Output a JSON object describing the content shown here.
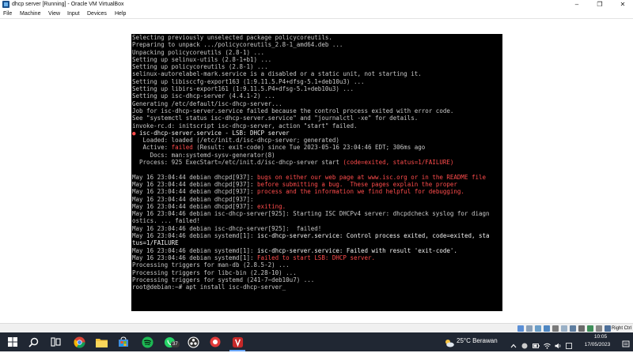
{
  "window": {
    "title": "dhcp server [Running] - Oracle VM VirtualBox",
    "minimize_icon": "minimize-icon",
    "restore_icon": "restore-icon",
    "close_icon": "close-icon"
  },
  "menubar": {
    "items": [
      "File",
      "Machine",
      "View",
      "Input",
      "Devices",
      "Help"
    ]
  },
  "console": {
    "lines": [
      [
        {
          "t": "Selecting previously unselected package policycoreutils."
        }
      ],
      [
        {
          "t": "Preparing to unpack .../policycoreutils_2.8-1_amd64.deb ..."
        }
      ],
      [
        {
          "t": "Unpacking policycoreutils (2.8-1) ..."
        }
      ],
      [
        {
          "t": "Setting up selinux-utils (2.8-1+b1) ..."
        }
      ],
      [
        {
          "t": "Setting up policycoreutils (2.8-1) ..."
        }
      ],
      [
        {
          "t": "selinux-autorelabel-mark.service is a disabled or a static unit, not starting it."
        }
      ],
      [
        {
          "t": "Setting up libisccfg-export163 (1:9.11.5.P4+dfsg-5.1+deb10u3) ..."
        }
      ],
      [
        {
          "t": "Setting up libirs-export161 (1:9.11.5.P4+dfsg-5.1+deb10u3) ..."
        }
      ],
      [
        {
          "t": "Setting up isc-dhcp-server (4.4.1-2) ..."
        }
      ],
      [
        {
          "t": "Generating /etc/default/isc-dhcp-server..."
        }
      ],
      [
        {
          "t": "Job for isc-dhcp-server.service failed because the control process exited with error code."
        }
      ],
      [
        {
          "t": "See \"systemctl status isc-dhcp-server.service\" and \"journalctl -xe\" for details."
        }
      ],
      [
        {
          "t": "invoke-rc.d: initscript isc-dhcp-server, action \"start\" failed."
        }
      ],
      [
        {
          "t": "●",
          "c": "red"
        },
        {
          "t": " isc-dhcp-server.service - LSB: DHCP server",
          "c": "white"
        }
      ],
      [
        {
          "t": "   Loaded: loaded (/etc/init.d/isc-dhcp-server; generated)"
        }
      ],
      [
        {
          "t": "   Active: "
        },
        {
          "t": "failed",
          "c": "red"
        },
        {
          "t": " (Result: exit-code) since Tue 2023-05-16 23:04:46 EDT; 306ms ago"
        }
      ],
      [
        {
          "t": "     Docs: man:systemd-sysv-generator(8)"
        }
      ],
      [
        {
          "t": "  Process: 925 ExecStart=/etc/init.d/isc-dhcp-server start "
        },
        {
          "t": "(code=exited, status=1/FAILURE)",
          "c": "red"
        }
      ],
      [
        {
          "t": ""
        }
      ],
      [
        {
          "t": "May 16 23:04:44 debian dhcpd[937]: "
        },
        {
          "t": "bugs on either our web page at www.isc.org or in the README file",
          "c": "red"
        }
      ],
      [
        {
          "t": "May 16 23:04:44 debian dhcpd[937]: "
        },
        {
          "t": "before submitting a bug.  These pages explain the proper",
          "c": "red"
        }
      ],
      [
        {
          "t": "May 16 23:04:44 debian dhcpd[937]: "
        },
        {
          "t": "process and the information we find helpful for debugging.",
          "c": "red"
        }
      ],
      [
        {
          "t": "May 16 23:04:44 debian dhcpd[937]:"
        }
      ],
      [
        {
          "t": "May 16 23:04:44 debian dhcpd[937]: "
        },
        {
          "t": "exiting.",
          "c": "red"
        }
      ],
      [
        {
          "t": "May 16 23:04:46 debian isc-dhcp-server[925]: Starting ISC DHCPv4 server: dhcpdcheck syslog for diagn"
        }
      ],
      [
        {
          "t": "ostics. ... failed!"
        }
      ],
      [
        {
          "t": "May 16 23:04:46 debian isc-dhcp-server[925]:  failed!"
        }
      ],
      [
        {
          "t": "May 16 23:04:46 debian systemd[1]: "
        },
        {
          "t": "isc-dhcp-server.service: Control process exited, code=exited, sta",
          "c": "white"
        }
      ],
      [
        {
          "t": "tus=1/FAILURE",
          "c": "white"
        }
      ],
      [
        {
          "t": "May 16 23:04:46 debian systemd[1]: "
        },
        {
          "t": "isc-dhcp-server.service: Failed with result 'exit-code'.",
          "c": "white"
        }
      ],
      [
        {
          "t": "May 16 23:04:46 debian systemd[1]: "
        },
        {
          "t": "Failed to start LSB: DHCP server.",
          "c": "red"
        }
      ],
      [
        {
          "t": "Processing triggers for man-db (2.8.5-2) ..."
        }
      ],
      [
        {
          "t": "Processing triggers for libc-bin (2.28-10) ..."
        }
      ],
      [
        {
          "t": "Processing triggers for systemd (241-7~deb10u7) ..."
        }
      ],
      [
        {
          "t": "root@debian:~# apt install isc-dhcp-server_"
        }
      ]
    ]
  },
  "statusbar": {
    "right_ctrl": "Right Ctrl"
  },
  "taskbar": {
    "weather": "25°C  Berawan",
    "time": "10:05",
    "date": "17/05/2023",
    "badge": "37"
  },
  "colors": {
    "console_bg": "#000000",
    "console_text": "#c8c8c8",
    "console_red": "#ff4c4c",
    "taskbar_bg": "#202733"
  }
}
